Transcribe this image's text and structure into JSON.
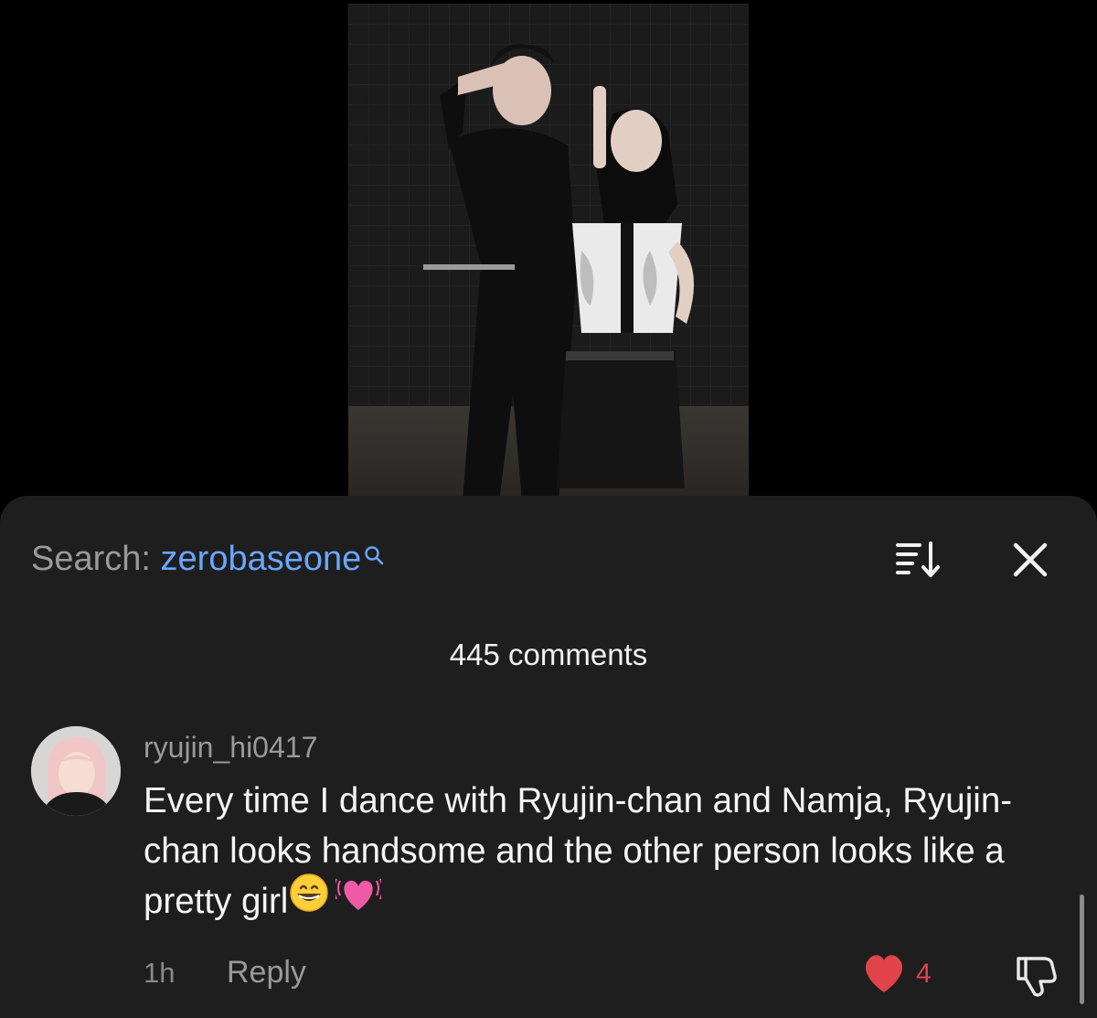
{
  "search": {
    "prefix": "Search: ",
    "term": "zerobaseone"
  },
  "comments_header": {
    "count_label": "445 comments"
  },
  "comment": {
    "username": "ryujin_hi0417",
    "text": "Every time I dance with Ryujin-chan and Namja, Ryujin-chan looks handsome and the other person looks like a pretty girl",
    "emojis": [
      "grinning-face",
      "beating-heart"
    ],
    "time": "1h",
    "reply_label": "Reply",
    "like_count": "4",
    "liked": true
  },
  "colors": {
    "sheet_background": "#1e1e1e",
    "search_term": "#6aa6ff",
    "like_red": "#e0434a"
  },
  "icons": {
    "search": "search-icon",
    "sort": "sort-icon",
    "close": "close-icon",
    "like": "heart-icon",
    "dislike": "thumbs-down-icon"
  }
}
